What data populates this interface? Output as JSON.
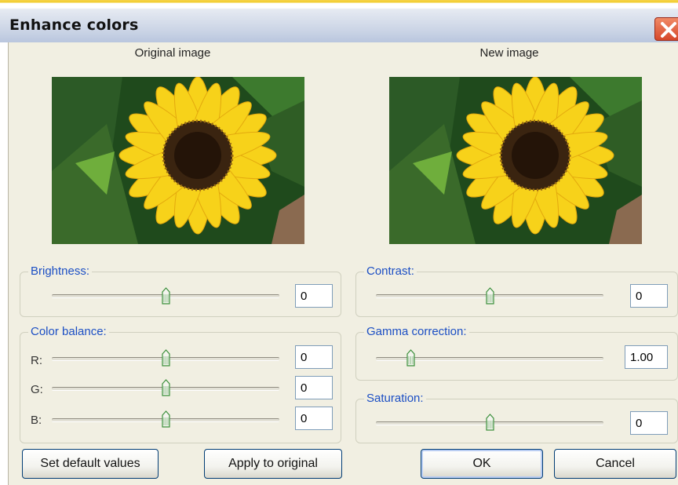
{
  "window": {
    "title": "Enhance colors"
  },
  "original": {
    "label": "Original image"
  },
  "preview": {
    "label": "New image"
  },
  "brightness": {
    "label": "Brightness:",
    "value": "0",
    "level": 0.5
  },
  "contrast": {
    "label": "Contrast:",
    "value": "0",
    "level": 0.5
  },
  "color_balance": {
    "label": "Color balance:",
    "channels": [
      {
        "label": "R:",
        "value": "0",
        "level": 0.5
      },
      {
        "label": "G:",
        "value": "0",
        "level": 0.5
      },
      {
        "label": "B:",
        "value": "0",
        "level": 0.5
      }
    ]
  },
  "gamma": {
    "label": "Gamma correction:",
    "value": "1.00",
    "level": 0.15
  },
  "saturation": {
    "label": "Saturation:",
    "value": "0",
    "level": 0.5
  },
  "buttons": {
    "defaults": "Set default values",
    "apply": "Apply to original",
    "ok": "OK",
    "cancel": "Cancel"
  },
  "icons": {
    "close": "close-icon",
    "slider_thumb": "slider-thumb-icon"
  },
  "colors": {
    "group_label": "#1c4fc4",
    "dialog_bg": "#f1efe2",
    "close_bg": "#d6472a"
  }
}
